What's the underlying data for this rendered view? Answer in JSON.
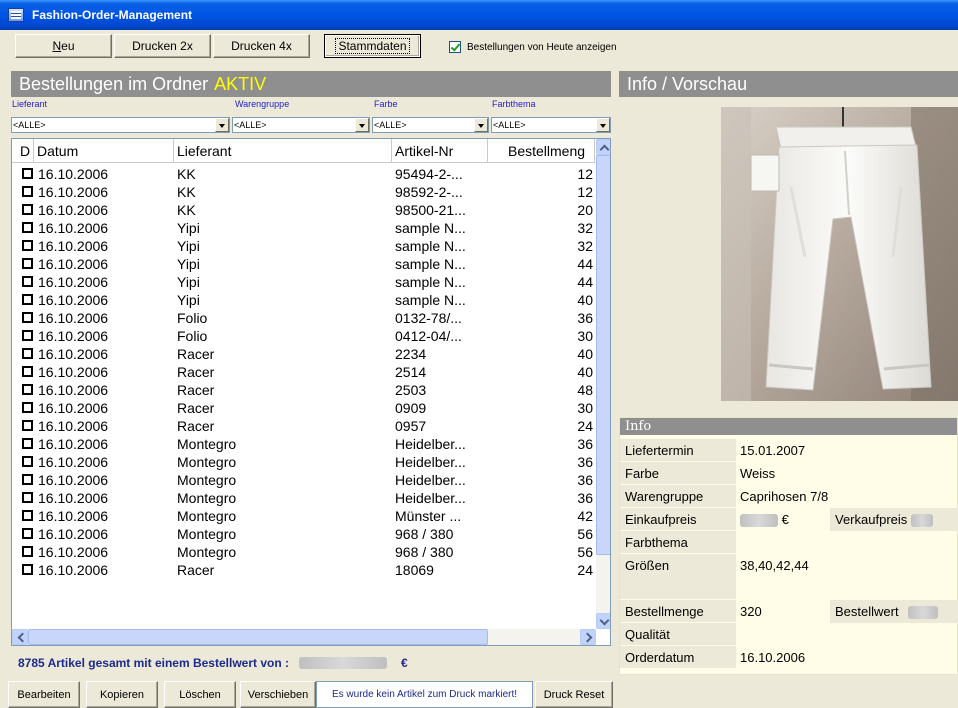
{
  "window": {
    "title": "Fashion-Order-Management"
  },
  "toolbar": {
    "new_label": "Neu",
    "new_mnemonic": "N",
    "new_rest": "eu",
    "print2_label": "Drucken 2x",
    "print4_label": "Drucken 4x",
    "master_label": "Stammdaten",
    "today_checkbox": {
      "label": "Bestellungen von Heute anzeigen",
      "checked": true
    }
  },
  "orders": {
    "header": "Bestellungen im Ordner",
    "folder_status": "AKTIV",
    "filters": [
      {
        "label": "Lieferant",
        "value": "<ALLE>"
      },
      {
        "label": "Warengruppe",
        "value": "<ALLE>"
      },
      {
        "label": "Farbe",
        "value": "<ALLE>"
      },
      {
        "label": "Farbthema",
        "value": "<ALLE>"
      }
    ],
    "columns": [
      "D",
      "Datum",
      "Lieferant",
      "Artikel-Nr",
      "Bestellmeng"
    ],
    "rows": [
      [
        "16.10.2006",
        "KK",
        "95494-2-...",
        "12"
      ],
      [
        "16.10.2006",
        "KK",
        "98592-2-...",
        "12"
      ],
      [
        "16.10.2006",
        "KK",
        "98500-21...",
        "20"
      ],
      [
        "16.10.2006",
        "Yipi",
        "sample N...",
        "32"
      ],
      [
        "16.10.2006",
        "Yipi",
        "sample N...",
        "32"
      ],
      [
        "16.10.2006",
        "Yipi",
        "sample N...",
        "44"
      ],
      [
        "16.10.2006",
        "Yipi",
        "sample N...",
        "44"
      ],
      [
        "16.10.2006",
        "Yipi",
        "sample N...",
        "40"
      ],
      [
        "16.10.2006",
        "Folio",
        "0132-78/...",
        "36"
      ],
      [
        "16.10.2006",
        "Folio",
        "0412-04/...",
        "30"
      ],
      [
        "16.10.2006",
        "Racer",
        "2234",
        "40"
      ],
      [
        "16.10.2006",
        "Racer",
        "2514",
        "40"
      ],
      [
        "16.10.2006",
        "Racer",
        "2503",
        "48"
      ],
      [
        "16.10.2006",
        "Racer",
        "0909",
        "30"
      ],
      [
        "16.10.2006",
        "Racer",
        "0957",
        "24"
      ],
      [
        "16.10.2006",
        "Montegro",
        "Heidelber...",
        "36"
      ],
      [
        "16.10.2006",
        "Montegro",
        "Heidelber...",
        "36"
      ],
      [
        "16.10.2006",
        "Montegro",
        "Heidelber...",
        "36"
      ],
      [
        "16.10.2006",
        "Montegro",
        "Heidelber...",
        "36"
      ],
      [
        "16.10.2006",
        "Montegro",
        "Münster ...",
        "42"
      ],
      [
        "16.10.2006",
        "Montegro",
        "968 / 380",
        "56"
      ],
      [
        "16.10.2006",
        "Montegro",
        "968 / 380",
        "56"
      ],
      [
        "16.10.2006",
        "Racer",
        "18069",
        "24"
      ]
    ],
    "total_prefix": "8785 Artikel gesamt mit einem Bestellwert von :",
    "total_currency": "€"
  },
  "bottom_bar": {
    "edit_label": "Bearbeiten",
    "copy_label": "Kopieren",
    "delete_label": "Löschen",
    "move_label": "Verschieben",
    "no_mark_text": "Es wurde kein Artikel zum Druck markiert!",
    "print_reset_label": "Druck Reset"
  },
  "info_panel": {
    "header": "Info / Vorschau",
    "section_title": "Info",
    "rows": {
      "liefertermin": {
        "label": "Liefertermin",
        "value": "15.01.2007"
      },
      "farbe": {
        "label": "Farbe",
        "value": "Weiss"
      },
      "warengruppe": {
        "label": "Warengruppe",
        "value": "Caprihosen 7/8"
      },
      "einkaufpreis": {
        "label": "Einkaufpreis",
        "currency": "€"
      },
      "verkaufpreis": {
        "label": "Verkaufpreis"
      },
      "farbthema": {
        "label": "Farbthema",
        "value": ""
      },
      "groessen": {
        "label": "Größen",
        "value": "38,40,42,44"
      },
      "bestellmenge": {
        "label": "Bestellmenge",
        "value": "320"
      },
      "bestellwert": {
        "label": "Bestellwert"
      },
      "qualitaet": {
        "label": "Qualität",
        "value": ""
      },
      "orderdatum": {
        "label": "Orderdatum",
        "value": "16.10.2006"
      }
    }
  },
  "colors": {
    "titlebar": "#0055e5",
    "panel_header": "#8f8f8f",
    "status_yellow": "#ffff00",
    "info_bg": "#fffde7",
    "total_text": "#1c2a8c"
  }
}
